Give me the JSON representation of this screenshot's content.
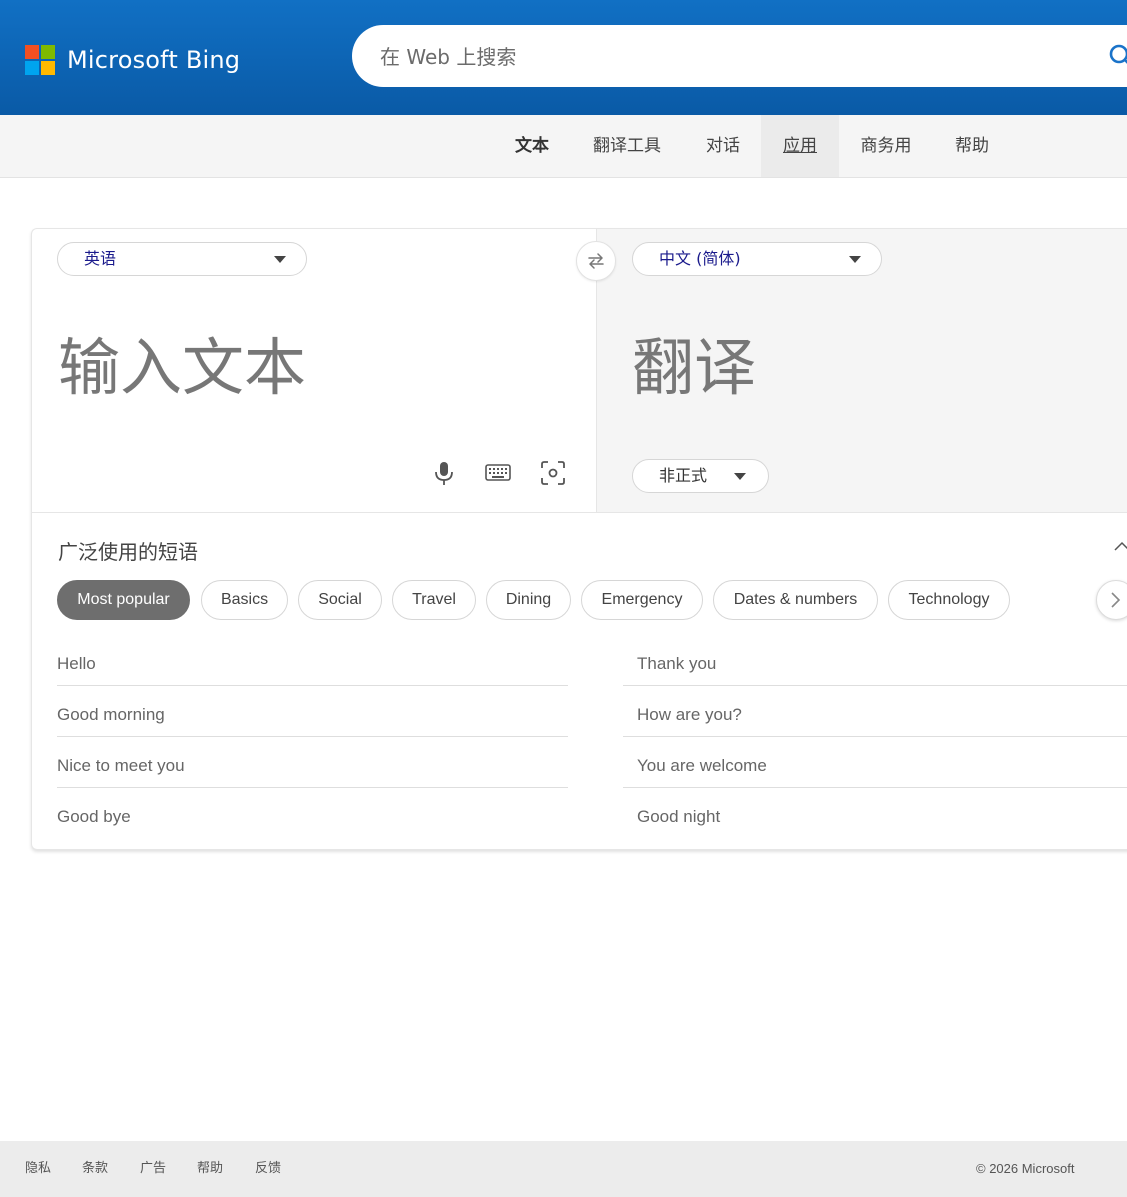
{
  "header": {
    "logo_text": "Microsoft Bing",
    "search_placeholder": "在 Web 上搜索",
    "logo_colors": [
      "#f25022",
      "#7fba00",
      "#00a4ef",
      "#ffb900"
    ]
  },
  "nav": {
    "items": [
      {
        "label": "文本"
      },
      {
        "label": "翻译工具"
      },
      {
        "label": "对话"
      },
      {
        "label": "应用"
      },
      {
        "label": "商务用"
      },
      {
        "label": "帮助"
      }
    ]
  },
  "translator": {
    "source_lang": "英语",
    "target_lang": "中文 (简体)",
    "source_placeholder": "输入文本",
    "target_placeholder": "翻译",
    "tone": "非正式",
    "icons": [
      "microphone-icon",
      "keyboard-icon",
      "camera-scan-icon",
      "swap-icon"
    ]
  },
  "phrases": {
    "title": "广泛使用的短语",
    "chips": [
      "Most popular",
      "Basics",
      "Social",
      "Travel",
      "Dining",
      "Emergency",
      "Dates & numbers",
      "Technology"
    ],
    "left": [
      "Hello",
      "Good morning",
      "Nice to meet you",
      "Good bye"
    ],
    "right": [
      "Thank you",
      "How are you?",
      "You are welcome",
      "Good night"
    ]
  },
  "footer": {
    "links": [
      "隐私",
      "条款",
      "广告",
      "帮助",
      "反馈"
    ],
    "copyright": "© 2026 Microsoft"
  }
}
